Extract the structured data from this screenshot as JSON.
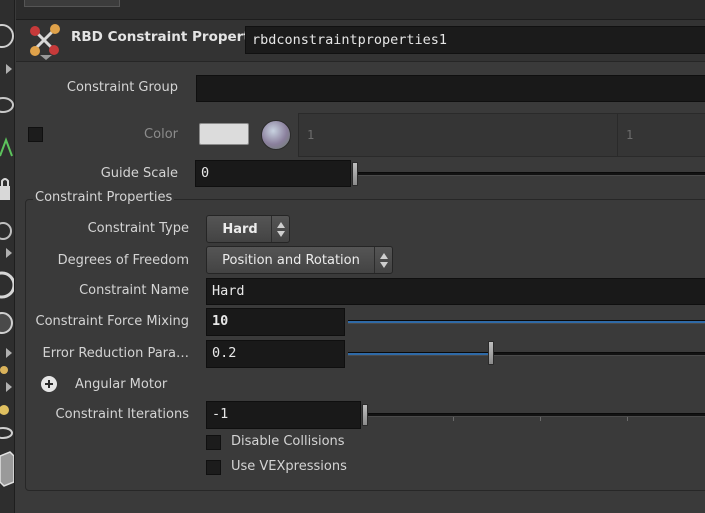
{
  "header": {
    "node_type_label": "RBD Constraint Properties",
    "node_name": "rbdconstraintproperties1"
  },
  "params": {
    "constraint_group": {
      "label": "Constraint Group",
      "value": ""
    },
    "color": {
      "label": "Color",
      "swatch_color": "#dcdcdc",
      "value_1": "1",
      "value_2": "1"
    },
    "guide_scale": {
      "label": "Guide Scale",
      "value": "0",
      "slider_fraction": 0.0
    }
  },
  "constraint_properties": {
    "title": "Constraint Properties",
    "constraint_type": {
      "label": "Constraint Type",
      "selected": "Hard"
    },
    "degrees_of_freedom": {
      "label": "Degrees of Freedom",
      "selected": "Position and Rotation"
    },
    "constraint_name": {
      "label": "Constraint Name",
      "value": "Hard"
    },
    "force_mixing": {
      "label": "Constraint Force Mixing",
      "value": "10",
      "slider_fraction": 1.0
    },
    "error_reduction": {
      "label": "Error Reduction Para…",
      "value": "0.2",
      "slider_fraction": 0.4
    },
    "angular_motor": {
      "label": "Angular Motor"
    },
    "iterations": {
      "label": "Constraint Iterations",
      "value": "-1"
    },
    "disable_collisions": {
      "label": "Disable Collisions",
      "checked": false
    },
    "use_vexpressions": {
      "label": "Use VEXpressions",
      "checked": false
    }
  },
  "theme": {
    "accent": "#2f6aa7",
    "background": "#3a3a3a",
    "field": "#191919"
  }
}
